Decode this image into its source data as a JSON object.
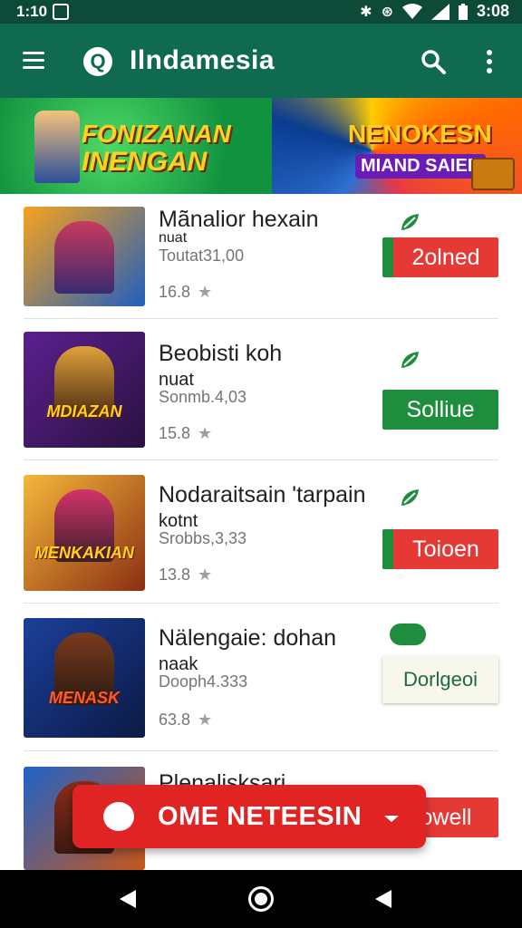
{
  "status": {
    "time": "1:10",
    "clock": "3:08"
  },
  "appbar": {
    "title": "Ilndamesia",
    "logo_letter": "Q"
  },
  "banner": {
    "left_line1": "FONIZANAN",
    "left_line2": "INENGAN",
    "right_line1": "NENOKESN",
    "right_line2": "MIAND SAIED"
  },
  "apps": [
    {
      "name": "Mãnalior hexain",
      "sub": "nuat",
      "meta": "Toutat31,00",
      "rating": "16.8",
      "thumb_text": "",
      "button": "2olned",
      "button_style": "red",
      "thumb_colors": [
        "#f7a21b",
        "#1f5fbf"
      ]
    },
    {
      "name": "Beobisti koh",
      "sub": "nuat",
      "meta": "Sonmb.4,03",
      "rating": "15.8",
      "thumb_text": "MDIAZAN",
      "button": "Solliue",
      "button_style": "green",
      "thumb_colors": [
        "#5b1f8f",
        "#2a1240"
      ]
    },
    {
      "name": "Nodaraitsain 'tarpain",
      "sub": "kotnt",
      "meta": "Srobbs,3,33",
      "rating": "13.8",
      "thumb_text": "MENKAKIAN",
      "button": "Toioen",
      "button_style": "red",
      "thumb_colors": [
        "#f5b73a",
        "#8a2f12"
      ]
    },
    {
      "name": "Nälengaie: dohan",
      "sub": "naak",
      "meta": "Dooph4.333",
      "rating": "63.8",
      "thumb_text": "MENASK",
      "button": "Dorlgeoi",
      "button_style": "light",
      "thumb_colors": [
        "#1b3f9a",
        "#0c1a45"
      ]
    },
    {
      "name": "Plenalisksari",
      "sub": "",
      "meta": "",
      "rating": "",
      "thumb_text": "",
      "button": "owell",
      "button_style": "red",
      "thumb_colors": [
        "#1f63c9",
        "#c8561a"
      ]
    }
  ],
  "fab": {
    "label": "OME NETEESIN"
  },
  "colors": {
    "appbar": "#0f6a4f",
    "statusbar": "#0d4a38",
    "accent_red": "#e53935",
    "accent_green": "#1e8e3e"
  }
}
